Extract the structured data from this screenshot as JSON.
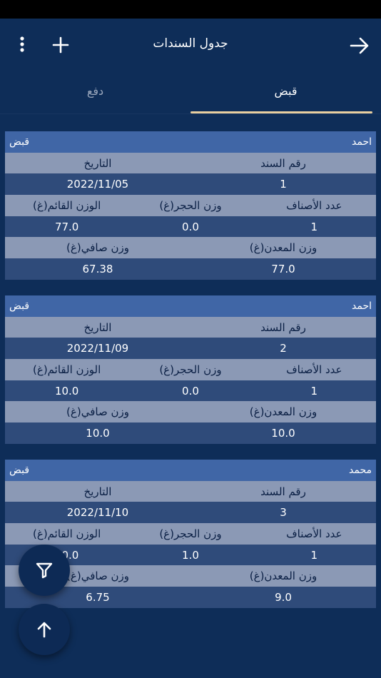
{
  "app_bar": {
    "title": "جدول السندات"
  },
  "tabs": {
    "receipt": "قبض",
    "payment": "دفع"
  },
  "icons": {
    "back": "arrow-right-icon",
    "add": "plus-icon",
    "more": "more-vert-icon",
    "filter": "filter-icon",
    "scroll_top": "arrow-up-icon"
  },
  "colors": {
    "background": "#0e2d58",
    "header": "#4066a6",
    "label_row": "#8b99b5",
    "value_row": "#2f4b7a",
    "tab_indicator": "#e8cfa0"
  },
  "labels": {
    "voucher_no": "رقم السند",
    "date": "التاريخ",
    "items_count": "عدد الأصناف",
    "stone_weight": "وزن الحجر(غ)",
    "gross_weight": "الوزن القائم(غ)",
    "metal_weight": "وزن المعدن(غ)",
    "net_weight": "وزن صافي(غ)"
  },
  "vouchers": [
    {
      "name": "احمد",
      "type": "قبض",
      "voucher_no": "1",
      "date": "2022/11/05",
      "items_count": "1",
      "stone_weight": "0.0",
      "gross_weight": "77.0",
      "metal_weight": "77.0",
      "net_weight": "67.38"
    },
    {
      "name": "احمد",
      "type": "قبض",
      "voucher_no": "2",
      "date": "2022/11/09",
      "items_count": "1",
      "stone_weight": "0.0",
      "gross_weight": "10.0",
      "metal_weight": "10.0",
      "net_weight": "10.0"
    },
    {
      "name": "محمد",
      "type": "قبض",
      "voucher_no": "3",
      "date": "2022/11/10",
      "items_count": "1",
      "stone_weight": "1.0",
      "gross_weight": "10.0",
      "metal_weight": "9.0",
      "net_weight": "6.75"
    }
  ]
}
